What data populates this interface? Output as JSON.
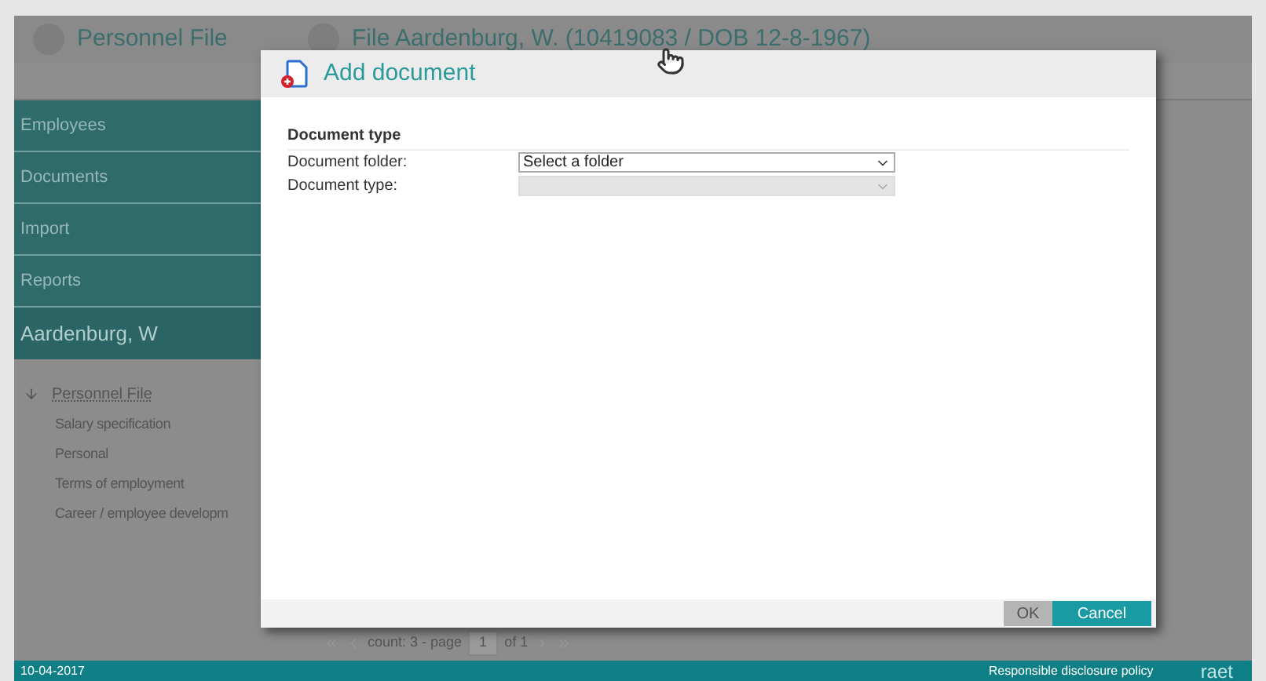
{
  "header": {
    "title": "Personnel File",
    "file_title": "File Aardenburg, W. (10419083 / DOB 12-8-1967)"
  },
  "nav": [
    {
      "label": "Employees",
      "selected": false
    },
    {
      "label": "Documents",
      "selected": false
    },
    {
      "label": "Import",
      "selected": false
    },
    {
      "label": "Reports",
      "selected": false
    }
  ],
  "employee": {
    "name": "Aardenburg, W"
  },
  "tree": {
    "label": "Personnel File",
    "expanded": true,
    "children": [
      {
        "label": "Salary specification"
      },
      {
        "label": "Personal"
      },
      {
        "label": "Terms of employment"
      },
      {
        "label": "Career / employee developm"
      }
    ]
  },
  "pager": {
    "count_text": "count: 3 - page",
    "page": "1",
    "of_text": "of 1"
  },
  "dialog": {
    "title": "Add document",
    "section": "Document type",
    "fields": [
      {
        "label": "Document folder:",
        "value": "Select a folder",
        "disabled": false
      },
      {
        "label": "Document type:",
        "disabled": true
      }
    ],
    "buttons": [
      {
        "label": "OK",
        "disabled": true,
        "kind": "primary"
      },
      {
        "label": "Cancel",
        "disabled": false,
        "kind": "secondary"
      }
    ]
  },
  "status_bar": {
    "date": "10-04-2017",
    "link": "Responsible disclosure policy",
    "logo": "raet"
  }
}
